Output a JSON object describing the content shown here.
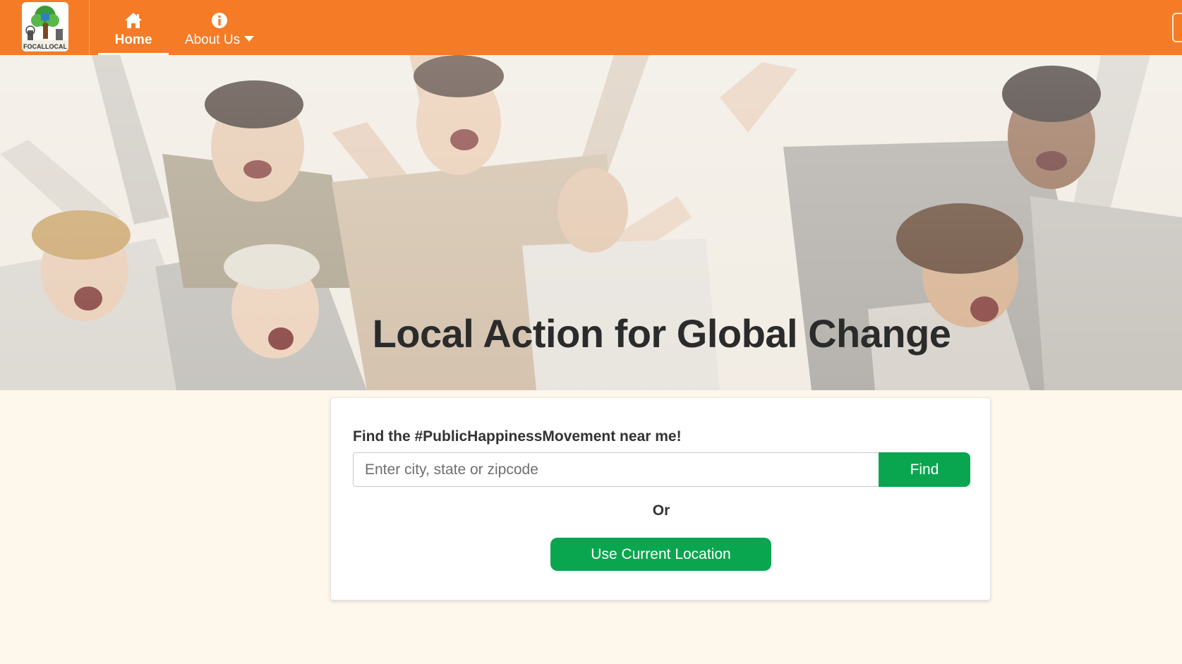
{
  "nav": {
    "logo_text": "FOCALLOCAL",
    "items": [
      {
        "label": "Home",
        "icon": "home-icon"
      },
      {
        "label": "About Us",
        "icon": "info-icon"
      }
    ]
  },
  "hero": {
    "title": "Local Action for Global Change"
  },
  "search": {
    "label": "Find the #PublicHappinessMovement near me!",
    "placeholder": "Enter city, state or zipcode",
    "find_label": "Find",
    "or_text": "Or",
    "location_label": "Use Current Location"
  },
  "colors": {
    "nav_bg": "#f57b26",
    "accent_green": "#0aa64f",
    "page_bg": "#fdf7ec"
  }
}
